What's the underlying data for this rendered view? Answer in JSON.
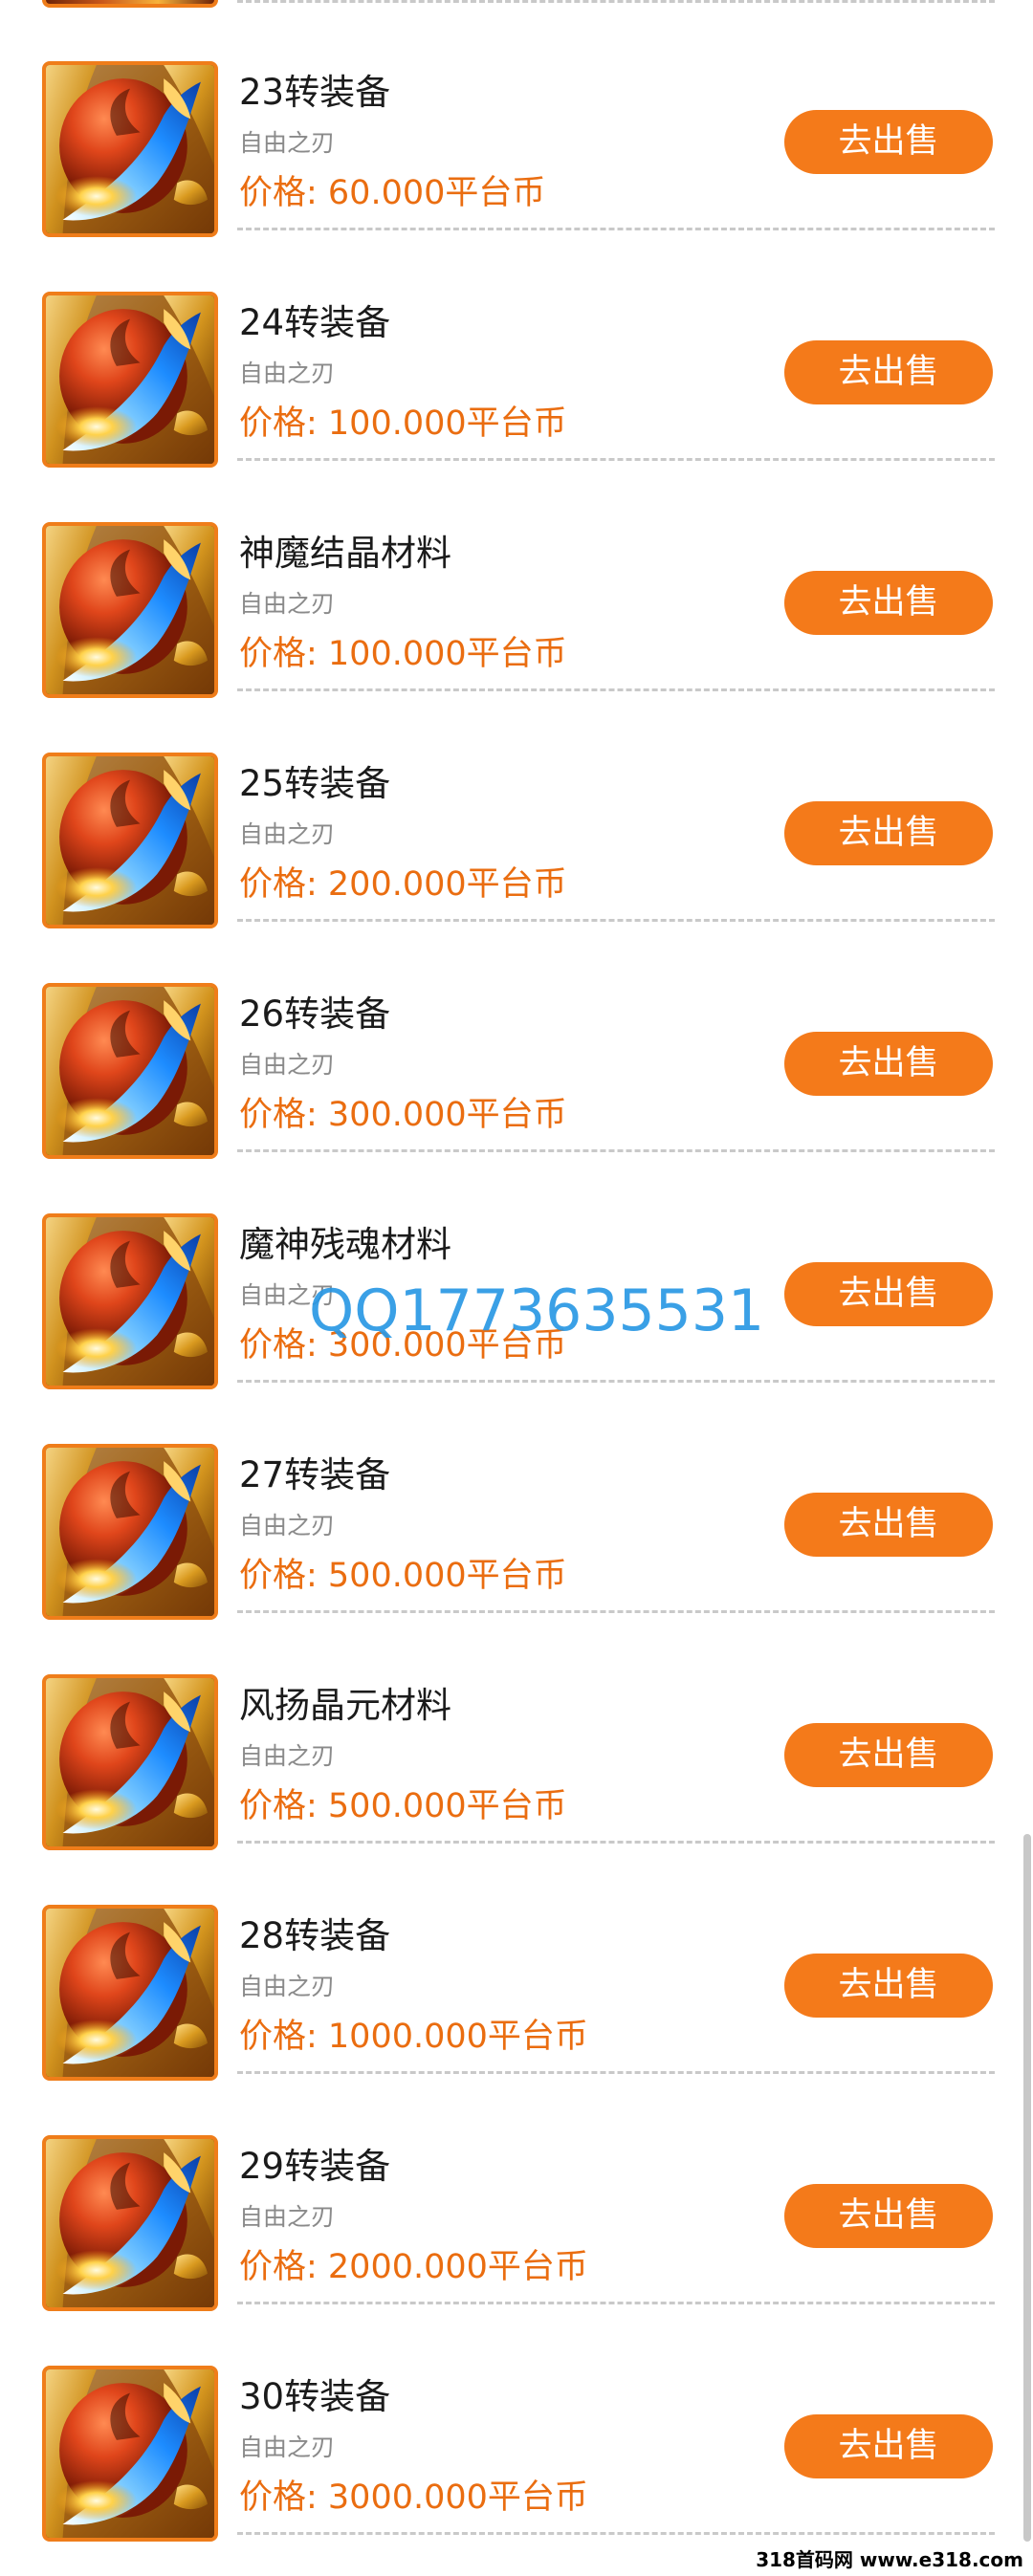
{
  "accent_color": "#f47a1a",
  "price_color": "#ea6d10",
  "icon": "game-emblem-icon",
  "items": [
    {
      "title": "23转装备",
      "subtitle": "自由之刃",
      "price": "价格: 60.000平台币",
      "button": "去出售"
    },
    {
      "title": "24转装备",
      "subtitle": "自由之刃",
      "price": "价格: 100.000平台币",
      "button": "去出售"
    },
    {
      "title": "神魔结晶材料",
      "subtitle": "自由之刃",
      "price": "价格: 100.000平台币",
      "button": "去出售"
    },
    {
      "title": "25转装备",
      "subtitle": "自由之刃",
      "price": "价格: 200.000平台币",
      "button": "去出售"
    },
    {
      "title": "26转装备",
      "subtitle": "自由之刃",
      "price": "价格: 300.000平台币",
      "button": "去出售"
    },
    {
      "title": "魔神残魂材料",
      "subtitle": "自由之刃",
      "price": "价格: 300.000平台币",
      "button": "去出售"
    },
    {
      "title": "27转装备",
      "subtitle": "自由之刃",
      "price": "价格: 500.000平台币",
      "button": "去出售"
    },
    {
      "title": "风扬晶元材料",
      "subtitle": "自由之刃",
      "price": "价格: 500.000平台币",
      "button": "去出售"
    },
    {
      "title": "28转装备",
      "subtitle": "自由之刃",
      "price": "价格: 1000.000平台币",
      "button": "去出售"
    },
    {
      "title": "29转装备",
      "subtitle": "自由之刃",
      "price": "价格: 2000.000平台币",
      "button": "去出售"
    },
    {
      "title": "30转装备",
      "subtitle": "自由之刃",
      "price": "价格: 3000.000平台币",
      "button": "去出售"
    }
  ],
  "watermark": "QQ1773635531",
  "footer_credit": "318首码网 www.e318.com"
}
